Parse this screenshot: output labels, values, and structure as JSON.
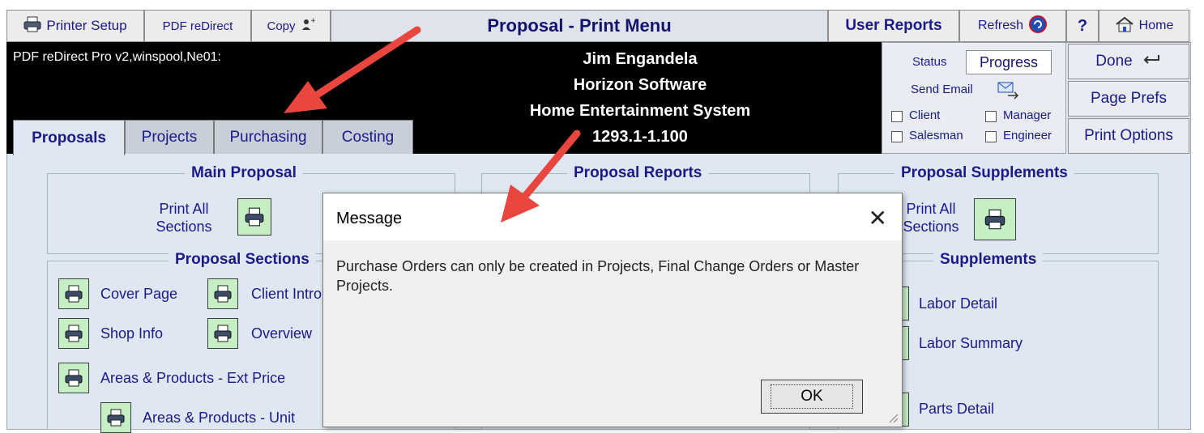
{
  "toolbar": {
    "printer_setup": "Printer Setup",
    "pdf_redirect": "PDF reDirect",
    "copy": "Copy",
    "title": "Proposal - Print Menu",
    "user_reports": "User Reports",
    "refresh": "Refresh",
    "help": "?",
    "home": "Home"
  },
  "header": {
    "printer_name": "PDF reDirect Pro v2,winspool,Ne01:",
    "client_name": "Jim Engandela",
    "company": "Horizon Software",
    "project": "Home Entertainment System",
    "proposal_number": "1293.1-1.100"
  },
  "tabs": [
    {
      "label": "Proposals",
      "active": true
    },
    {
      "label": "Projects",
      "active": false
    },
    {
      "label": "Purchasing",
      "active": false
    },
    {
      "label": "Costing",
      "active": false
    }
  ],
  "status_panel": {
    "status_label": "Status",
    "status_value": "Progress",
    "send_email": "Send Email",
    "checkboxes": [
      "Client",
      "Manager",
      "Salesman",
      "Engineer"
    ]
  },
  "right_buttons": {
    "done": "Done",
    "page_prefs": "Page Prefs",
    "print_options": "Print Options"
  },
  "main_proposal": {
    "heading": "Main Proposal",
    "print_all_line1": "Print All",
    "print_all_line2": "Sections"
  },
  "proposal_sections": {
    "heading": "Proposal Sections",
    "items": [
      "Cover Page",
      "Client Intro",
      "Shop Info",
      "Overview",
      "Areas & Products - Ext Price",
      "Areas & Products - Unit"
    ]
  },
  "proposal_reports": {
    "heading": "Proposal Reports"
  },
  "proposal_supplements": {
    "heading": "Proposal Supplements",
    "print_all_line1": "Print All",
    "print_all_line2": "Sections"
  },
  "supplements": {
    "heading": "Supplements",
    "items": [
      "Labor Detail",
      "Labor Summary",
      "Parts Detail"
    ]
  },
  "dialog": {
    "title": "Message",
    "message": "Purchase Orders can only be created in Projects, Final Change Orders or Master Projects.",
    "ok": "OK"
  },
  "colors": {
    "accent_text": "#1a1a8c",
    "print_button_bg": "#c6efc6",
    "header_band": "#000000",
    "panel_bg": "#dfe8f2",
    "arrow": "#e8463e"
  }
}
